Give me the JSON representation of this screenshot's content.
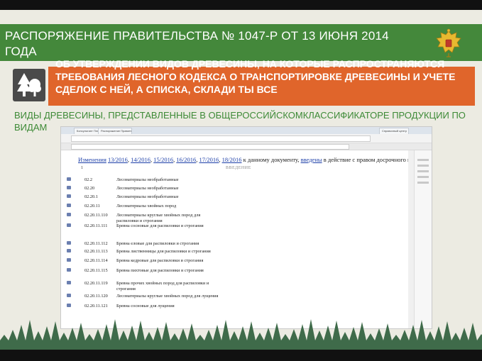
{
  "slide": {
    "title": "РАСПОРЯЖЕНИЕ ПРАВИТЕЛЬСТВА № 1047-Р ОТ 13 ИЮНЯ 2014 ГОДА",
    "orange_text": "ОБ УТВЕРЖДЕНИИ ВИДОВ ДРЕВЕСИНЫ, НА КОТОРЫЕ РАСПРОСТРАНЯЮТСЯ ТРЕБОВАНИЯ ЛЕСНОГО КОДЕКСА О ТРАНСПОРТИРОВКЕ ДРЕВЕСИНЫ И УЧЕТЕ СДЕЛОК С НЕЙ, А СПИСКА, СКЛАДИ ТЫ ВСЕ",
    "subtitle": "ВИДЫ ДРЕВЕСИНЫ, ПРЕДСТАВЛЕННЫЕ В ОБЩЕРОССИЙСКОМКЛАССИФИКАТОРЕ ПРОДУКЦИИ ПО ВИДАМ",
    "colors": {
      "green": "#44883b",
      "orange": "#e0652b",
      "tree_box": "#4a4a4a"
    }
  },
  "screenshot": {
    "tabs": [
      "Консультант Плюс",
      "Распоряжение Правител",
      "Справочный центр"
    ],
    "changes": {
      "prefix": "Изменения",
      "links": [
        "13/2016",
        "14/2016",
        "15/2016",
        "16/2016",
        "17/2016",
        "18/2016"
      ],
      "middle": "к данному документу,",
      "link_introduced": "введены",
      "suffix": "в действие с правом досрочного при"
    },
    "header_one": "1",
    "vveden": "ВВЕДЕНИЕ",
    "rows": [
      {
        "code": "02.2",
        "name": "Лесоматериалы необработанные"
      },
      {
        "code": "02.20",
        "name": "Лесоматериалы необработанные"
      },
      {
        "code": "02.20.1",
        "name": "Лесоматериалы необработанные"
      },
      {
        "code": "02.20.11",
        "name": "Лесоматериалы хвойных пород"
      },
      {
        "code": "02.20.11.110",
        "name": "Лесоматериалы круглые хвойных пород для распиловки и строгания"
      },
      {
        "code": "02.20.11.111",
        "name": "Бревна сосновые для распиловки и строгания"
      },
      {
        "code": "02.20.11.112",
        "name": "Бревна еловые для распиловки и строгания"
      },
      {
        "code": "02.20.11.113",
        "name": "Бревна лиственницы для распиловки и строгания"
      },
      {
        "code": "02.20.11.114",
        "name": "Бревна кедровые для распиловки и строгания"
      },
      {
        "code": "02.20.11.115",
        "name": "Бревна пихтовые для распиловки и строгания"
      },
      {
        "code": "02.20.11.119",
        "name": "Бревна прочих хвойных пород для распиловки и строгания"
      },
      {
        "code": "02.20.11.120",
        "name": "Лесоматериалы круглые хвойных пород для лущения"
      },
      {
        "code": "02.20.11.121",
        "name": "Бревна сосновые для лущения"
      }
    ]
  }
}
